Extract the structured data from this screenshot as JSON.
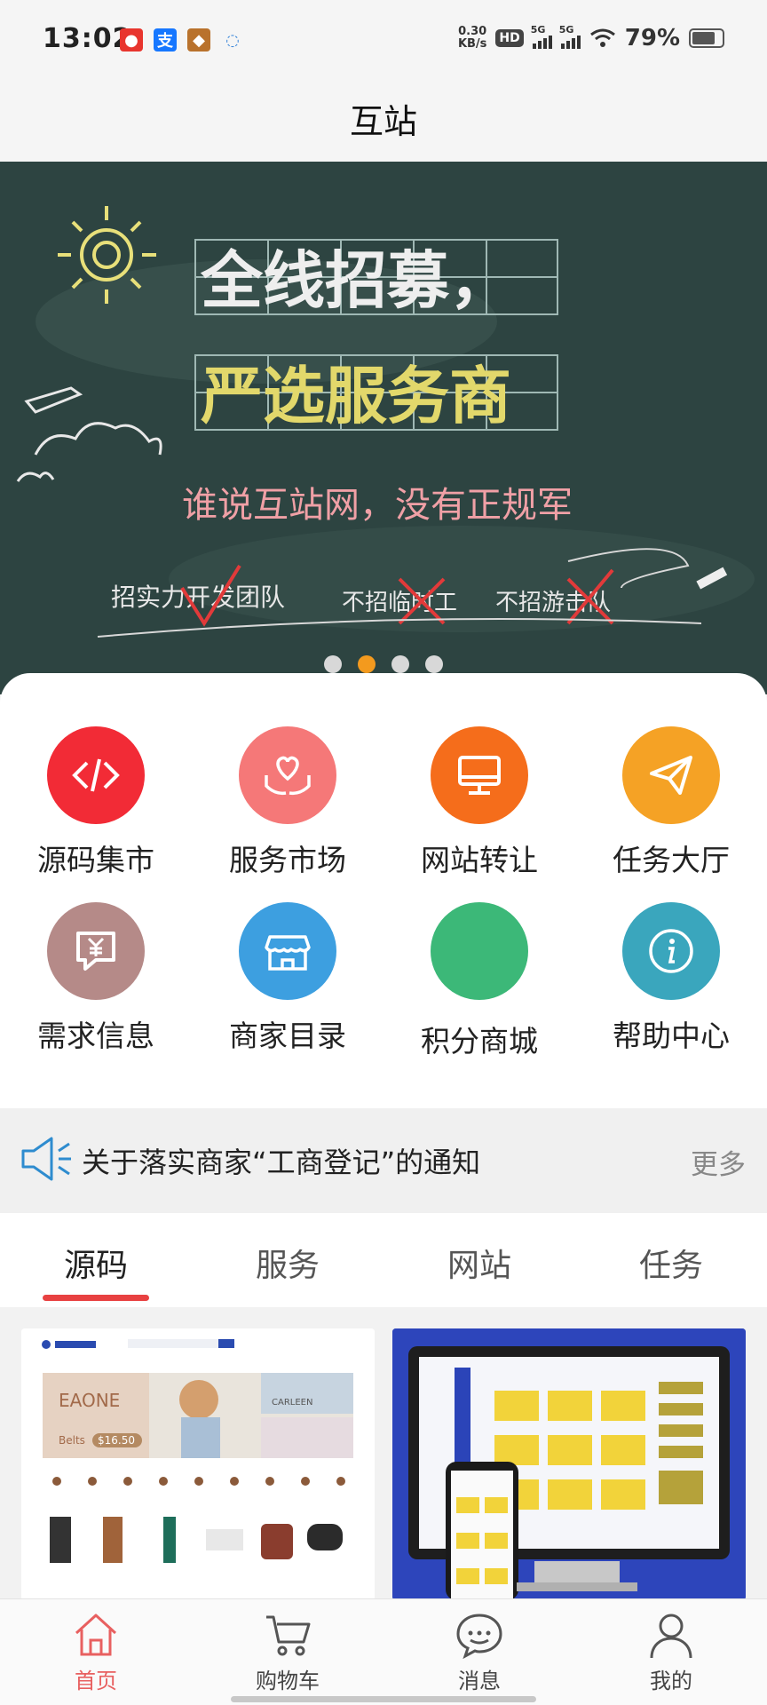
{
  "status_bar": {
    "time": "13:02",
    "net_speed_value": "0.30",
    "net_speed_unit": "KB/s",
    "hd_badge": "HD",
    "signal_labels": [
      "5G",
      "5G"
    ],
    "battery_percent": "79%",
    "battery_level": 0.79
  },
  "header": {
    "title": "互站"
  },
  "banner": {
    "line1": "全线招募，",
    "line2": "严选服务商",
    "slogan": "谁说互站网，没有正规军",
    "tags": [
      "招实力开发团队",
      "不招临时工",
      "不招游击队"
    ],
    "dots": 4,
    "active_dot": 2
  },
  "quick_menu": [
    {
      "label": "源码集市",
      "icon": "code-icon",
      "color": "#f22b36"
    },
    {
      "label": "服务市场",
      "icon": "heart-hands-icon",
      "color": "#f57878"
    },
    {
      "label": "网站转让",
      "icon": "monitor-icon",
      "color": "#f56d1b"
    },
    {
      "label": "任务大厅",
      "icon": "paper-plane-icon",
      "color": "#f5a225"
    },
    {
      "label": "需求信息",
      "icon": "yuan-chat-icon",
      "color": "#b58a88"
    },
    {
      "label": "商家目录",
      "icon": "store-icon",
      "color": "#3d9fe0"
    },
    {
      "label": "积分商城",
      "icon": "",
      "color": "#3cb878"
    },
    {
      "label": "帮助中心",
      "icon": "info-icon",
      "color": "#3aa6bd"
    }
  ],
  "notice": {
    "text": "关于落实商家“工商登记”的通知",
    "more": "更多"
  },
  "tabs": [
    {
      "label": "源码",
      "active": true
    },
    {
      "label": "服务",
      "active": false
    },
    {
      "label": "网站",
      "active": false
    },
    {
      "label": "任务",
      "active": false
    }
  ],
  "products": [
    {
      "thumb_text": "EAONE",
      "sub": "Belts",
      "price": "$16.50",
      "thumb2": "CARLEEN"
    },
    {
      "thumb_text": ""
    }
  ],
  "bottom_nav": [
    {
      "label": "首页",
      "icon": "home-icon",
      "active": true
    },
    {
      "label": "购物车",
      "icon": "cart-icon",
      "active": false
    },
    {
      "label": "消息",
      "icon": "chat-icon",
      "active": false
    },
    {
      "label": "我的",
      "icon": "user-icon",
      "active": false
    }
  ]
}
